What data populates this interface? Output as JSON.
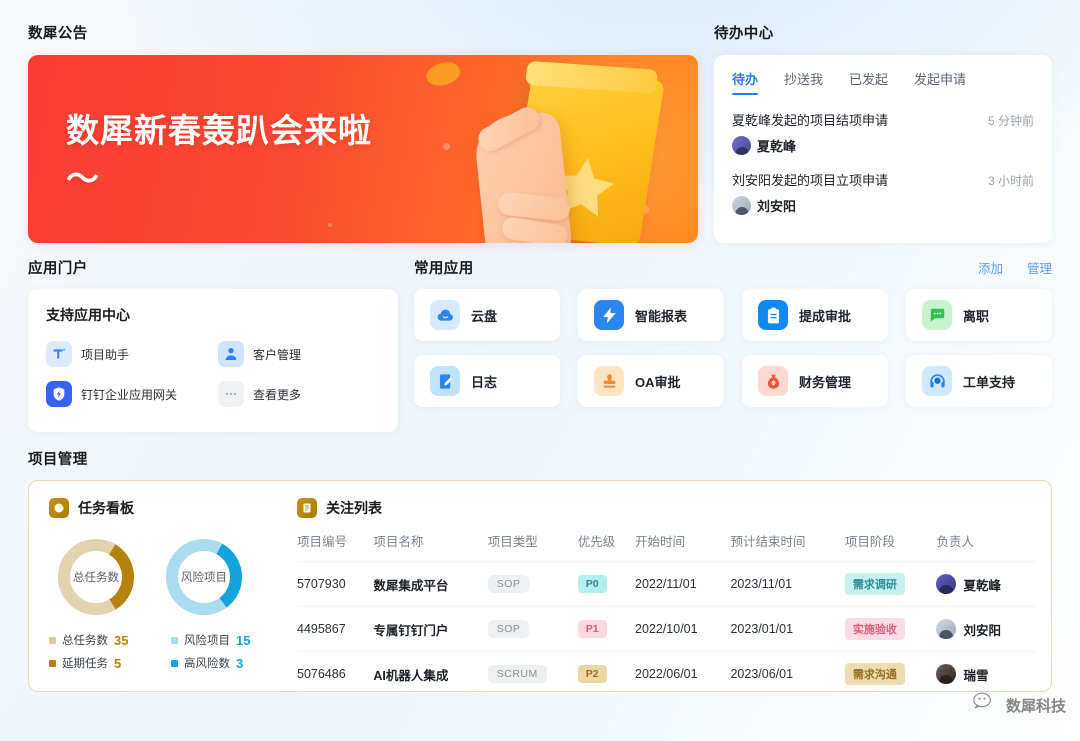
{
  "announcement": {
    "section_title": "数犀公告",
    "banner_text": "数犀新春轰趴会来啦～"
  },
  "todo": {
    "section_title": "待办中心",
    "tabs": [
      {
        "label": "待办",
        "active": true
      },
      {
        "label": "抄送我",
        "active": false
      },
      {
        "label": "已发起",
        "active": false
      },
      {
        "label": "发起申请",
        "active": false
      }
    ],
    "items": [
      {
        "title": "夏乾峰发起的项目结项申请",
        "time": "5 分钟前",
        "user": "夏乾峰"
      },
      {
        "title": "刘安阳发起的项目立项申请",
        "time": "3 小时前",
        "user": "刘安阳"
      }
    ]
  },
  "portal": {
    "section_title": "应用门户",
    "card_title": "支持应用中心",
    "items": [
      {
        "label": "项目助手",
        "icon": "project-assistant-icon"
      },
      {
        "label": "客户管理",
        "icon": "customer-management-icon"
      },
      {
        "label": "钉钉企业应用网关",
        "icon": "dingtalk-gateway-icon"
      },
      {
        "label": "查看更多",
        "icon": "more-dots-icon"
      }
    ]
  },
  "common_apps": {
    "section_title": "常用应用",
    "add_label": "添加",
    "manage_label": "管理",
    "apps": [
      {
        "label": "云盘",
        "icon": "cloud-icon",
        "bg": "#d6eafd",
        "fg": "#2b86f0"
      },
      {
        "label": "智能报表",
        "icon": "lightning-report-icon",
        "bg": "#2b86f0",
        "fg": "#ffffff"
      },
      {
        "label": "提成审批",
        "icon": "clipboard-icon",
        "bg": "#1189f5",
        "fg": "#ffffff"
      },
      {
        "label": "离职",
        "icon": "chat-bubble-icon",
        "bg": "#c9f2cf",
        "fg": "#35c152"
      },
      {
        "label": "日志",
        "icon": "notebook-pen-icon",
        "bg": "#bfe2fd",
        "fg": "#2b86f0"
      },
      {
        "label": "OA审批",
        "icon": "stamp-icon",
        "bg": "#fde4c3",
        "fg": "#f08a34"
      },
      {
        "label": "财务管理",
        "icon": "money-bag-icon",
        "bg": "#fdd9d2",
        "fg": "#f1543a"
      },
      {
        "label": "工单支持",
        "icon": "headset-icon",
        "bg": "#cfe8fd",
        "fg": "#2b86f0"
      }
    ]
  },
  "project_management": {
    "section_title": "项目管理",
    "task_board": {
      "title": "任务看板",
      "icon": "pie-chart-icon",
      "legend": [
        {
          "label": "总任务数",
          "value": "35",
          "color": "#ddcaa0"
        },
        {
          "label": "风险项目",
          "value": "15",
          "color": "#a5dbec"
        },
        {
          "label": "延期任务",
          "value": "5",
          "color": "#b5830d"
        },
        {
          "label": "高风险数",
          "value": "3",
          "color": "#13a4dd"
        }
      ],
      "donuts": [
        {
          "label": "总任务数",
          "track": "#e2d3ae",
          "arc": "#b5830d",
          "pct": 33
        },
        {
          "label": "风险项目",
          "track": "#a9dcee",
          "arc": "#13a4dd",
          "pct": 32
        }
      ]
    },
    "watch_list": {
      "title": "关注列表",
      "icon": "list-doc-icon",
      "columns": [
        "项目编号",
        "项目名称",
        "项目类型",
        "优先级",
        "开始时间",
        "预计结束时间",
        "项目阶段",
        "负责人"
      ],
      "rows": [
        {
          "id": "5707930",
          "name": "数犀集成平台",
          "type": "SOP",
          "priority": "P0",
          "priority_bg": "#b5eef0",
          "priority_fg": "#2c8b97",
          "start": "2022/11/01",
          "end": "2023/11/01",
          "stage": "需求调研",
          "stage_bg": "#c6eff0",
          "stage_fg": "#2f8d96",
          "owner": "夏乾峰",
          "avatar": "avatar-purple"
        },
        {
          "id": "4495867",
          "name": "专属钉钉门户",
          "type": "SOP",
          "priority": "P1",
          "priority_bg": "#fbd8e0",
          "priority_fg": "#e0566f",
          "start": "2022/10/01",
          "end": "2023/01/01",
          "stage": "实施验收",
          "stage_bg": "#fbdce6",
          "stage_fg": "#df5e77",
          "owner": "刘安阳",
          "avatar": "avatar-grey"
        },
        {
          "id": "5076486",
          "name": "AI机器人集成",
          "type": "SCRUM",
          "priority": "P2",
          "priority_bg": "#ead7a4",
          "priority_fg": "#9a7516",
          "start": "2022/06/01",
          "end": "2023/06/01",
          "stage": "需求沟通",
          "stage_bg": "#ecdcb0",
          "stage_fg": "#96731a",
          "owner": "瑞雪",
          "avatar": "avatar-dark"
        }
      ]
    }
  },
  "watermark": {
    "text": "数犀科技",
    "icon": "wechat-icon"
  }
}
